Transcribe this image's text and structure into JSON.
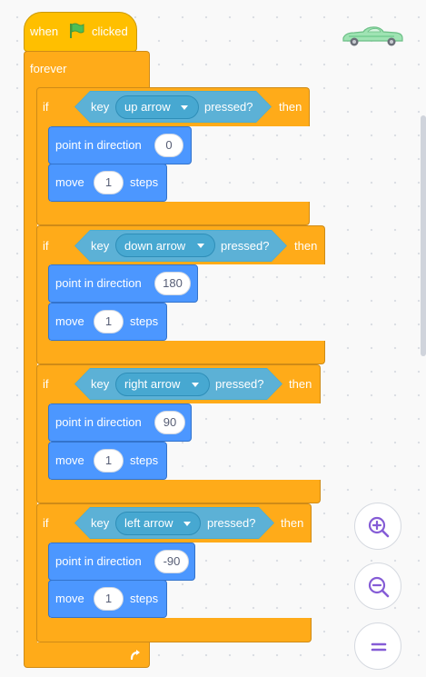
{
  "hat": {
    "when": "when",
    "clicked": "clicked"
  },
  "forever": {
    "label": "forever"
  },
  "if_blocks": [
    {
      "if_label": "if",
      "key_label": "key",
      "key": "up arrow",
      "pressed_label": "pressed?",
      "then_label": "then",
      "direction_label": "point in direction",
      "direction": "0",
      "move_label": "move",
      "steps": "1",
      "steps_label": "steps"
    },
    {
      "if_label": "if",
      "key_label": "key",
      "key": "down arrow",
      "pressed_label": "pressed?",
      "then_label": "then",
      "direction_label": "point in direction",
      "direction": "180",
      "move_label": "move",
      "steps": "1",
      "steps_label": "steps"
    },
    {
      "if_label": "if",
      "key_label": "key",
      "key": "right arrow",
      "pressed_label": "pressed?",
      "then_label": "then",
      "direction_label": "point in direction",
      "direction": "90",
      "move_label": "move",
      "steps": "1",
      "steps_label": "steps"
    },
    {
      "if_label": "if",
      "key_label": "key",
      "key": "left arrow",
      "pressed_label": "pressed?",
      "then_label": "then",
      "direction_label": "point in direction",
      "direction": "-90",
      "move_label": "move",
      "steps": "1",
      "steps_label": "steps"
    }
  ],
  "icons": {
    "flag": "green-flag-icon",
    "loop": "loop-arrow-icon",
    "zoom_in": "zoom-in-icon",
    "zoom_out": "zoom-out-icon",
    "reset": "reset-zoom-icon",
    "sprite": "car-sprite-icon"
  },
  "colors": {
    "events": "#ffbf00",
    "control": "#ffab19",
    "sensing": "#5cb1d6",
    "motion": "#4c97ff",
    "flag": "#4cbf56",
    "zoom_icon": "#855cd6"
  }
}
